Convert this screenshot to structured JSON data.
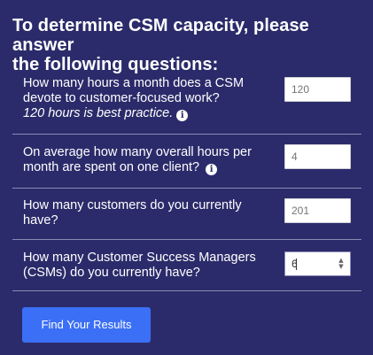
{
  "form": {
    "title_line1": "To determine CSM capacity, please answer",
    "title_line2": "the following questions:",
    "questions": [
      {
        "label_line1": "How many hours a month does a CSM",
        "label_line2": "devote to customer-focused work?",
        "hint": "120 hours is best practice.",
        "placeholder": "120",
        "value": ""
      },
      {
        "label_line1": "On average how many overall hours per",
        "label_line2": "month are spent on one client?",
        "placeholder": "4",
        "value": ""
      },
      {
        "label_line1": "How many customers do you currently",
        "label_line2": "have?",
        "placeholder": "201",
        "value": ""
      },
      {
        "label_line1": "How many Customer Success Managers",
        "label_line2": "(CSMs) do you currently have?",
        "placeholder": "",
        "value": "6"
      }
    ],
    "submit_label": "Find Your Results"
  },
  "icons": {
    "info": "info-icon",
    "stepper": "number-stepper-icon"
  },
  "colors": {
    "background": "#2b2b6b",
    "button": "#3b6ff5",
    "divider": "#8a8ab4"
  }
}
